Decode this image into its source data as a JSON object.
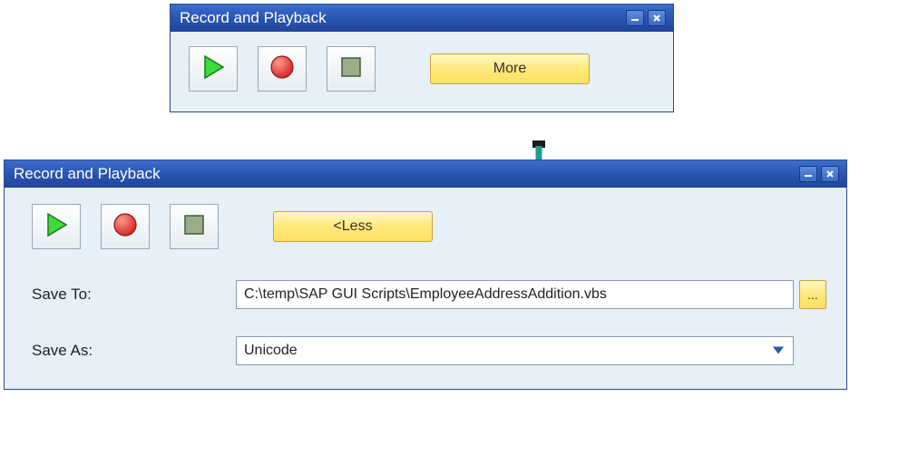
{
  "window_small": {
    "title": "Record and Playback",
    "buttons": {
      "more_label": "More"
    }
  },
  "window_large": {
    "title": "Record and Playback",
    "buttons": {
      "less_label": "<Less"
    },
    "save_to_label": "Save To:",
    "save_to_value": "C:\\temp\\SAP GUI Scripts\\EmployeeAddressAddition.vbs",
    "browse_label": "...",
    "save_as_label": "Save As:",
    "save_as_value": "Unicode"
  }
}
